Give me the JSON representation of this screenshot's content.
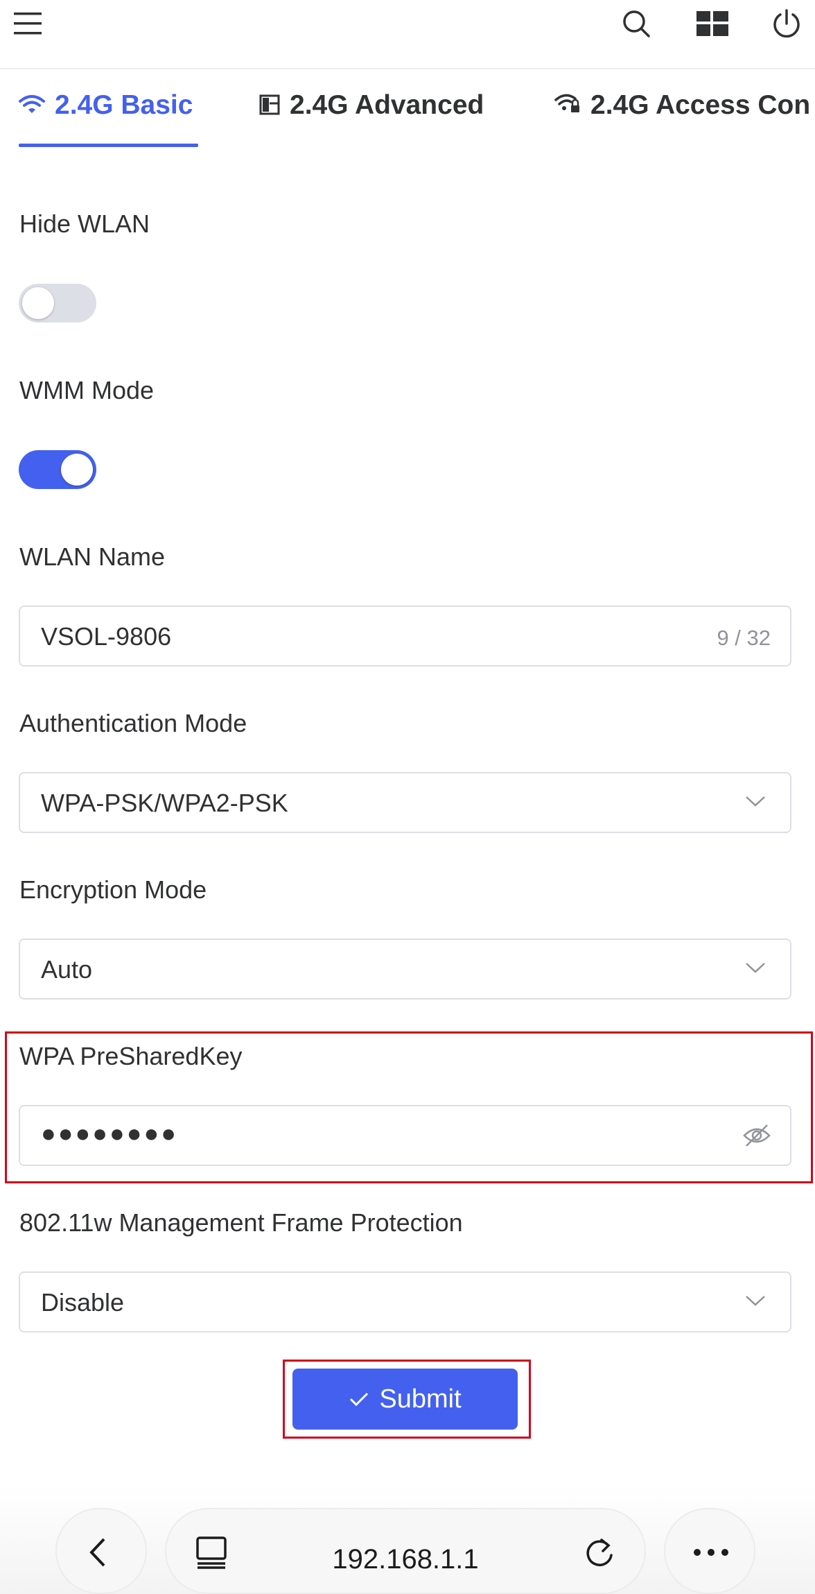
{
  "topbar": {
    "menu_icon": "hamburger-icon",
    "search_icon": "search-icon",
    "apps_icon": "dashboard-grid-icon",
    "power_icon": "power-icon"
  },
  "tabs": [
    {
      "label": "2.4G Basic",
      "icon": "wifi-icon",
      "active": true
    },
    {
      "label": "2.4G Advanced",
      "icon": "panel-icon",
      "active": false
    },
    {
      "label": "2.4G Access Con",
      "icon": "wifi-lock-icon",
      "active": false
    }
  ],
  "form": {
    "hide_wlan": {
      "label": "Hide WLAN",
      "enabled": false
    },
    "wmm_mode": {
      "label": "WMM Mode",
      "enabled": true
    },
    "wlan_name": {
      "label": "WLAN Name",
      "value": "VSOL-9806",
      "counter": "9 / 32"
    },
    "auth_mode": {
      "label": "Authentication Mode",
      "value": "WPA-PSK/WPA2-PSK"
    },
    "encryption_mode": {
      "label": "Encryption Mode",
      "value": "Auto"
    },
    "psk": {
      "label": "WPA PreSharedKey",
      "value": "●●●●●●●●"
    },
    "mfp": {
      "label": "802.11w Management Frame Protection",
      "value": "Disable"
    },
    "submit_label": "Submit"
  },
  "browser": {
    "url": "192.168.1.1",
    "back_icon": "chevron-left-icon",
    "tabs_icon": "tabs-icon",
    "reload_icon": "reload-icon",
    "more_icon": "more-dots-icon"
  },
  "colors": {
    "accent": "#4361ee",
    "highlight": "#d0021b",
    "border": "#dcdfe6"
  }
}
